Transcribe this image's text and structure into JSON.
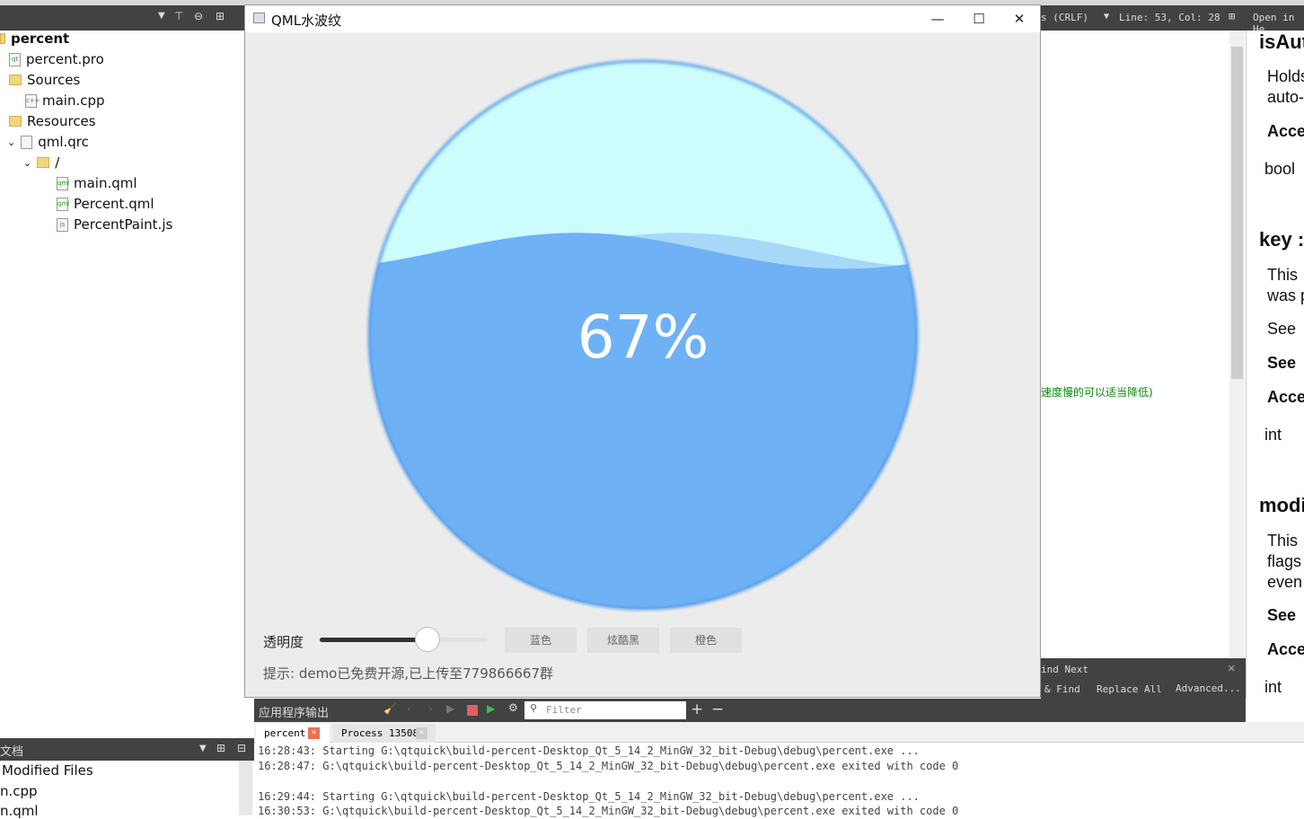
{
  "left_panel": {
    "tree": [
      {
        "label": "percent",
        "bold": true,
        "depth": 0
      },
      {
        "label": "percent.pro",
        "depth": 1
      },
      {
        "label": "Sources",
        "depth": 1
      },
      {
        "label": "main.cpp",
        "depth": 2
      },
      {
        "label": "Resources",
        "depth": 1
      },
      {
        "label": "qml.qrc",
        "depth": 2
      },
      {
        "label": "/",
        "depth": 3
      },
      {
        "label": "main.qml",
        "depth": 4
      },
      {
        "label": "Percent.qml",
        "depth": 4
      },
      {
        "label": "PercentPaint.js",
        "depth": 4
      }
    ],
    "docs_title": "文档",
    "docs": [
      "Modified Files",
      "n.cpp",
      "n.qml"
    ]
  },
  "qml_window": {
    "title": "QML水波纹",
    "percent_text": "67%",
    "percent": 67,
    "colors": {
      "background": "#ccfcfc",
      "water": "#6fb1f5",
      "wave_back": "#a8d8f8",
      "border": "#5a9ee8"
    },
    "opacity_label": "透明度",
    "opacity_value": 0.64,
    "buttons": [
      "蓝色",
      "炫酷黑",
      "橙色"
    ],
    "hint": "提示: demo已免费开源,已上传至779866667群"
  },
  "editor": {
    "encoding": "s (CRLF)",
    "position": "Line: 53, Col: 28",
    "comment": "速度慢的可以适当降低)",
    "find": {
      "find_next": "ind Next",
      "replace_find": "& Find",
      "replace_all": "Replace All",
      "advanced": "Advanced..."
    }
  },
  "help": {
    "open_in": "Open in He",
    "lines": [
      "isAut",
      "Holds",
      "auto-",
      "Acce",
      "bool",
      "key :",
      "This",
      "was p",
      "See",
      "See",
      "Acce",
      "int",
      "modi",
      "This",
      "flags",
      "even",
      "See",
      "Acce",
      "int"
    ]
  },
  "output": {
    "title": "应用程序输出",
    "filter_placeholder": "Filter",
    "tabs": [
      "percent",
      "Process 13508"
    ],
    "log": [
      "16:28:43: Starting G:\\qtquick\\build-percent-Desktop_Qt_5_14_2_MinGW_32_bit-Debug\\debug\\percent.exe ...",
      "16:28:47: G:\\qtquick\\build-percent-Desktop_Qt_5_14_2_MinGW_32_bit-Debug\\debug\\percent.exe exited with code 0",
      "",
      "16:29:44: Starting G:\\qtquick\\build-percent-Desktop_Qt_5_14_2_MinGW_32_bit-Debug\\debug\\percent.exe ...",
      "16:30:53: G:\\qtquick\\build-percent-Desktop_Qt_5_14_2_MinGW_32_bit-Debug\\debug\\percent.exe exited with code 0"
    ]
  }
}
